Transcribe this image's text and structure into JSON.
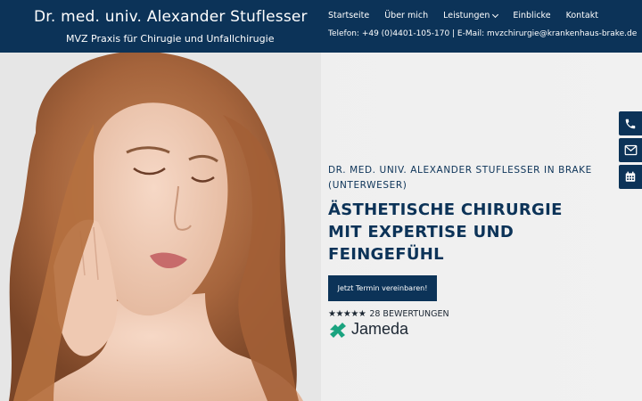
{
  "header": {
    "brand_name": "Dr. med. univ. Alexander Stuflesser",
    "brand_sub": "MVZ Praxis für Chirugie und Unfallchirugie",
    "nav": [
      {
        "label": "Startseite"
      },
      {
        "label": "Über mich"
      },
      {
        "label": "Leistungen"
      },
      {
        "label": "Einblicke"
      },
      {
        "label": "Kontakt"
      }
    ],
    "contact_line": "Telefon: +49 (0)4401-105-170 | E-Mail: mvzchirurgie@krankenhaus-brake.de"
  },
  "hero": {
    "pre_title": "Dr. med. univ. Alexander Stuflesser in Brake (Unterweser)",
    "title": "ÄSTHETISCHE CHIRURGIE MIT EXPERTISE UND FEINGEFÜHL",
    "cta_label": "Jetzt Termin vereinbaren!",
    "stars": "★★★★★",
    "rating_text": "28 BEWERTUNGEN",
    "jameda_label": "Jameda"
  },
  "side_buttons": [
    {
      "icon": "phone-icon"
    },
    {
      "icon": "mail-icon"
    },
    {
      "icon": "calendar-icon"
    }
  ],
  "colors": {
    "brand_navy": "#0c3358",
    "jameda_green": "#1aa37f"
  }
}
